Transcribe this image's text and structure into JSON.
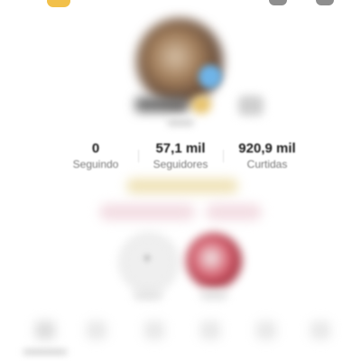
{
  "profile": {
    "stats": [
      {
        "value": "0",
        "label": "Seguindo"
      },
      {
        "value": "57,1 mil",
        "label": "Seguidores"
      },
      {
        "value": "920,9 mil",
        "label": "Curtidas"
      }
    ]
  },
  "icons": {
    "avatar": "profile-avatar",
    "badge": "verified-badge-icon",
    "plus": "plus-icon"
  },
  "colors": {
    "text_primary": "#1b1b1b",
    "text_secondary": "#7a7a7a",
    "background": "#ffffff"
  }
}
